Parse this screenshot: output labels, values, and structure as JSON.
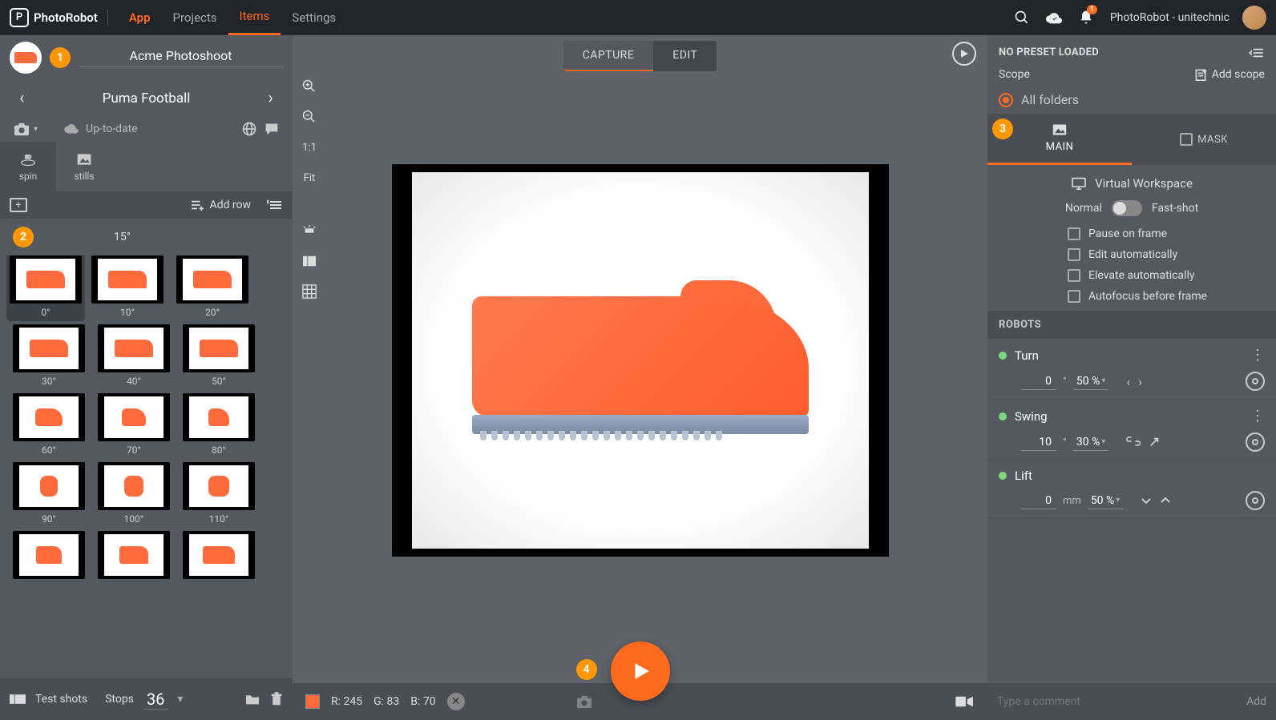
{
  "header": {
    "brand": "PhotoRobot",
    "app_label": "App",
    "nav": [
      "Projects",
      "Items",
      "Settings"
    ],
    "active_nav": "Items",
    "notifications_count": "1",
    "user_label": "PhotoRobot - unitechnic"
  },
  "left": {
    "project_name": "Acme Photoshoot",
    "item_name": "Puma Football",
    "sync_status": "Up-to-date",
    "tabs": {
      "spin": "spin",
      "stills": "stills"
    },
    "add_row": "Add row",
    "row_angle": "15°",
    "thumbs": [
      [
        "0°",
        "10°",
        "20°"
      ],
      [
        "30°",
        "40°",
        "50°"
      ],
      [
        "60°",
        "70°",
        "80°"
      ],
      [
        "90°",
        "100°",
        "110°"
      ],
      [
        "",
        "",
        ""
      ]
    ],
    "test_shots": "Test shots",
    "stops_label": "Stops",
    "stops_value": "36"
  },
  "center": {
    "modes": {
      "capture": "CAPTURE",
      "edit": "EDIT"
    },
    "active_mode": "CAPTURE",
    "view_tools": {
      "ratio": "1:1",
      "fit": "Fit"
    },
    "color_readout": {
      "r": "R: 245",
      "g": "G: 83",
      "b": "B: 70"
    }
  },
  "right": {
    "preset_label": "NO PRESET LOADED",
    "scope_label": "Scope",
    "add_scope": "Add scope",
    "scope_option": "All folders",
    "tabs": {
      "main": "MAIN",
      "mask": "MASK"
    },
    "virtual_workspace": "Virtual Workspace",
    "shot_mode": {
      "normal": "Normal",
      "fast": "Fast-shot"
    },
    "checks": [
      "Pause on frame",
      "Edit automatically",
      "Elevate automatically",
      "Autofocus before frame"
    ],
    "robots_header": "ROBOTS",
    "robots": {
      "turn": {
        "name": "Turn",
        "value": "0",
        "unit": "°",
        "speed": "50 %"
      },
      "swing": {
        "name": "Swing",
        "value": "10",
        "unit": "°",
        "speed": "30 %"
      },
      "lift": {
        "name": "Lift",
        "value": "0",
        "unit": "mm",
        "speed": "50 %"
      }
    },
    "comment_placeholder": "Type a comment",
    "add_label": "Add"
  },
  "markers": {
    "m1": "1",
    "m2": "2",
    "m3": "3",
    "m4": "4"
  }
}
